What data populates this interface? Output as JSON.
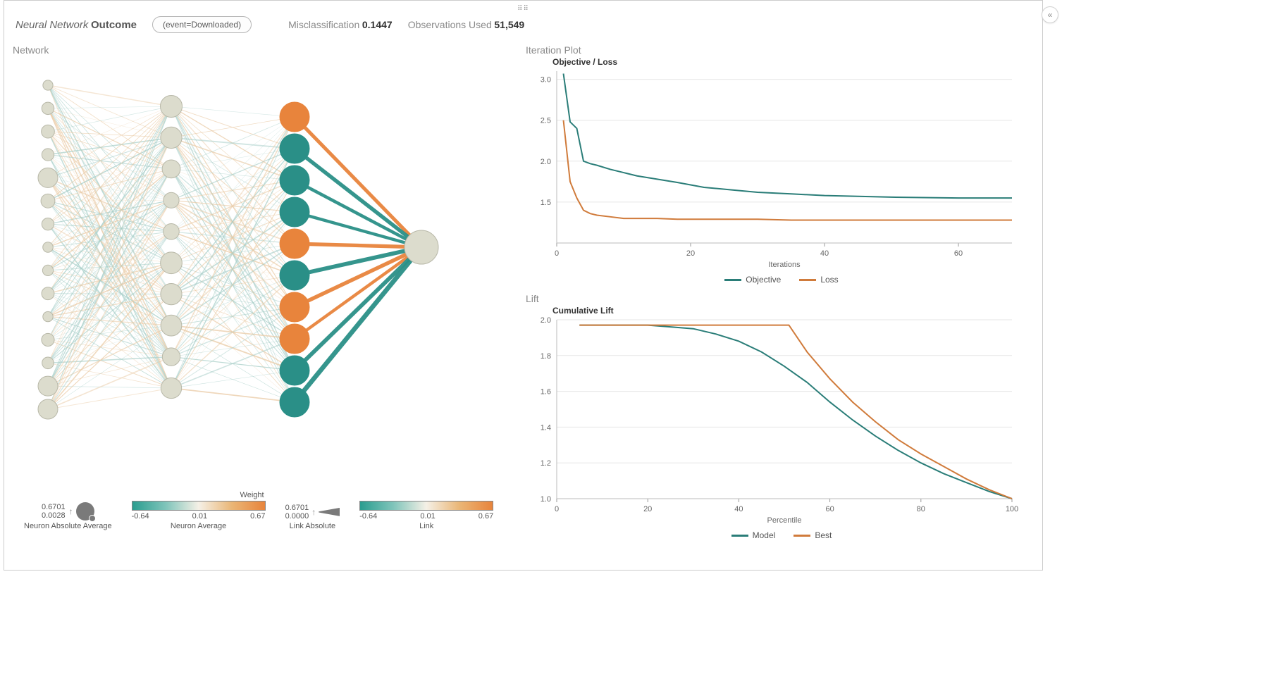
{
  "header": {
    "model_label": "Neural Network",
    "target_label": "Outcome",
    "event_button": "(event=Downloaded)",
    "misclass_label": "Misclassification",
    "misclass_value": "0.1447",
    "obs_label": "Observations Used",
    "obs_value": "51,549"
  },
  "network": {
    "title": "Network",
    "legends": {
      "neuron_size": {
        "label": "Neuron Absolute Average",
        "max": "0.6701",
        "min": "0.0028"
      },
      "neuron_avg": {
        "label_top": "Weight",
        "label_bottom": "Neuron Average",
        "ticks": [
          "-0.64",
          "0.01",
          "0.67"
        ]
      },
      "link_abs": {
        "label": "Link Absolute",
        "max": "0.6701",
        "min": "0.0000"
      },
      "link": {
        "label": "Link",
        "ticks": [
          "-0.64",
          "0.01",
          "0.67"
        ]
      }
    },
    "colors": {
      "teal": "#2a8f87",
      "teal_light": "#a7cec8",
      "orange": "#e8843c",
      "orange_light": "#e9c9a3",
      "neutral": "#e3e4d6",
      "node_grey": "#dcdccd"
    }
  },
  "chart_data": [
    {
      "id": "iteration",
      "type": "line",
      "panel_title": "Iteration Plot",
      "title": "Objective / Loss",
      "xlabel": "Iterations",
      "xlim": [
        0,
        68
      ],
      "x_ticks": [
        0,
        20,
        40,
        60
      ],
      "ylim": [
        1.0,
        3.1
      ],
      "y_ticks": [
        1.5,
        2.0,
        2.5,
        3.0
      ],
      "series": [
        {
          "name": "Objective",
          "color": "#2a7d78",
          "x": [
            1,
            2,
            3,
            4,
            5,
            6,
            8,
            10,
            12,
            15,
            18,
            22,
            26,
            30,
            35,
            40,
            50,
            60,
            68
          ],
          "y": [
            3.07,
            2.48,
            2.4,
            2.0,
            1.97,
            1.95,
            1.9,
            1.86,
            1.82,
            1.78,
            1.74,
            1.68,
            1.65,
            1.62,
            1.6,
            1.58,
            1.56,
            1.55,
            1.55
          ]
        },
        {
          "name": "Loss",
          "color": "#d07b3b",
          "x": [
            1,
            2,
            3,
            4,
            5,
            6,
            8,
            10,
            12,
            15,
            18,
            22,
            26,
            30,
            35,
            40,
            50,
            60,
            68
          ],
          "y": [
            2.5,
            1.75,
            1.55,
            1.4,
            1.36,
            1.34,
            1.32,
            1.3,
            1.3,
            1.3,
            1.29,
            1.29,
            1.29,
            1.29,
            1.28,
            1.28,
            1.28,
            1.28,
            1.28
          ]
        }
      ]
    },
    {
      "id": "lift",
      "type": "line",
      "panel_title": "Lift",
      "title": "Cumulative Lift",
      "xlabel": "Percentile",
      "xlim": [
        0,
        100
      ],
      "x_ticks": [
        0,
        20,
        40,
        60,
        80,
        100
      ],
      "ylim": [
        1.0,
        2.0
      ],
      "y_ticks": [
        1.0,
        1.2,
        1.4,
        1.6,
        1.8,
        2.0
      ],
      "series": [
        {
          "name": "Model",
          "color": "#2a7d78",
          "x": [
            5,
            10,
            15,
            20,
            25,
            30,
            35,
            40,
            45,
            50,
            55,
            60,
            65,
            70,
            75,
            80,
            85,
            90,
            95,
            100
          ],
          "y": [
            1.97,
            1.97,
            1.97,
            1.97,
            1.96,
            1.95,
            1.92,
            1.88,
            1.82,
            1.74,
            1.65,
            1.54,
            1.44,
            1.35,
            1.27,
            1.2,
            1.14,
            1.09,
            1.04,
            1.0
          ]
        },
        {
          "name": "Best",
          "color": "#d07b3b",
          "x": [
            5,
            10,
            15,
            20,
            25,
            30,
            35,
            40,
            45,
            50,
            51,
            55,
            60,
            65,
            70,
            75,
            80,
            85,
            90,
            95,
            100
          ],
          "y": [
            1.97,
            1.97,
            1.97,
            1.97,
            1.97,
            1.97,
            1.97,
            1.97,
            1.97,
            1.97,
            1.97,
            1.82,
            1.67,
            1.54,
            1.43,
            1.33,
            1.25,
            1.18,
            1.11,
            1.05,
            1.0
          ]
        }
      ]
    }
  ]
}
